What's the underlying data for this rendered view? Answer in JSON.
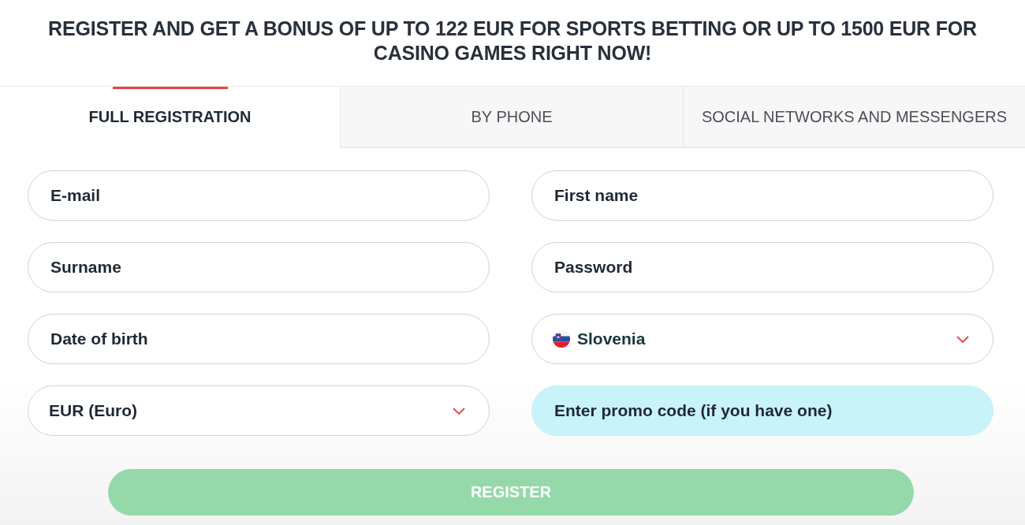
{
  "headline": "REGISTER AND GET A BONUS OF UP TO 122 EUR FOR SPORTS BETTING OR UP TO 1500 EUR FOR CASINO GAMES RIGHT NOW!",
  "tabs": [
    {
      "label": "FULL REGISTRATION",
      "selected": true
    },
    {
      "label": "BY PHONE",
      "selected": false
    },
    {
      "label": "SOCIAL NETWORKS AND MESSENGERS",
      "selected": false
    }
  ],
  "fields": [
    {
      "kind": "text",
      "placeholder": "E-mail"
    },
    {
      "kind": "text",
      "placeholder": "First name"
    },
    {
      "kind": "text",
      "placeholder": "Surname"
    },
    {
      "kind": "text",
      "placeholder": "Password"
    },
    {
      "kind": "text",
      "placeholder": "Date of birth"
    },
    {
      "kind": "country",
      "value": "Slovenia"
    },
    {
      "kind": "select",
      "value": "EUR (Euro)"
    },
    {
      "kind": "promo",
      "placeholder": "Enter promo code (if you have one)"
    }
  ],
  "register_button": {
    "label": "REGISTER"
  }
}
